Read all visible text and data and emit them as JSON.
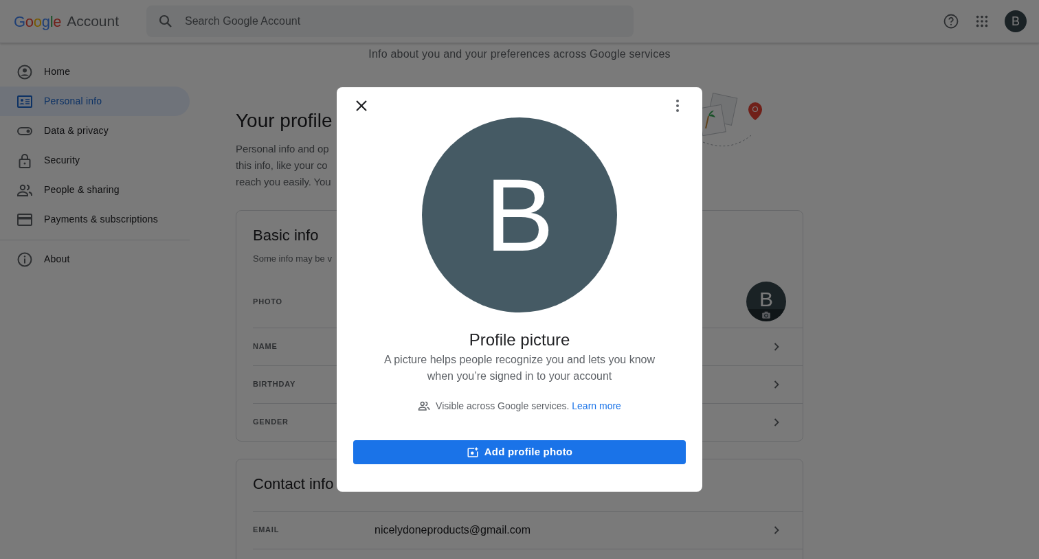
{
  "header": {
    "logo": "Google",
    "product": "Account",
    "search": {
      "placeholder": "Search Google Account"
    },
    "avatar_letter": "B"
  },
  "sidebar": {
    "items": [
      {
        "label": "Home",
        "selected": false
      },
      {
        "label": "Personal info",
        "selected": true
      },
      {
        "label": "Data & privacy",
        "selected": false
      },
      {
        "label": "Security",
        "selected": false
      },
      {
        "label": "People & sharing",
        "selected": false
      },
      {
        "label": "Payments & subscriptions",
        "selected": false
      }
    ],
    "bottom_items": [
      {
        "label": "About",
        "selected": false
      }
    ]
  },
  "page": {
    "subtitle": "Info about you and your preferences across Google services",
    "title": "Your profile",
    "intro_lines": [
      "Personal info and op",
      "this info, like your co",
      "reach you easily. You"
    ]
  },
  "basic_info": {
    "title": "Basic info",
    "subtitle": "Some info may be v",
    "rows": [
      {
        "kind": "photo",
        "label": "PHOTO",
        "avatar_letter": "B"
      },
      {
        "kind": "field",
        "label": "NAME"
      },
      {
        "kind": "field",
        "label": "BIRTHDAY"
      },
      {
        "kind": "field",
        "label": "GENDER"
      }
    ]
  },
  "contact_info": {
    "title": "Contact info",
    "rows": [
      {
        "kind": "field",
        "label": "EMAIL",
        "value": "nicelydoneproducts@gmail.com"
      },
      {
        "kind": "empty"
      }
    ]
  },
  "dialog": {
    "avatar_letter": "B",
    "title": "Profile picture",
    "description_lines": [
      "A picture helps people recognize you and lets you know",
      "when you’re signed in to your account"
    ],
    "visibility": "Visible across Google services.",
    "link": "Learn more",
    "button": "Add profile photo"
  }
}
